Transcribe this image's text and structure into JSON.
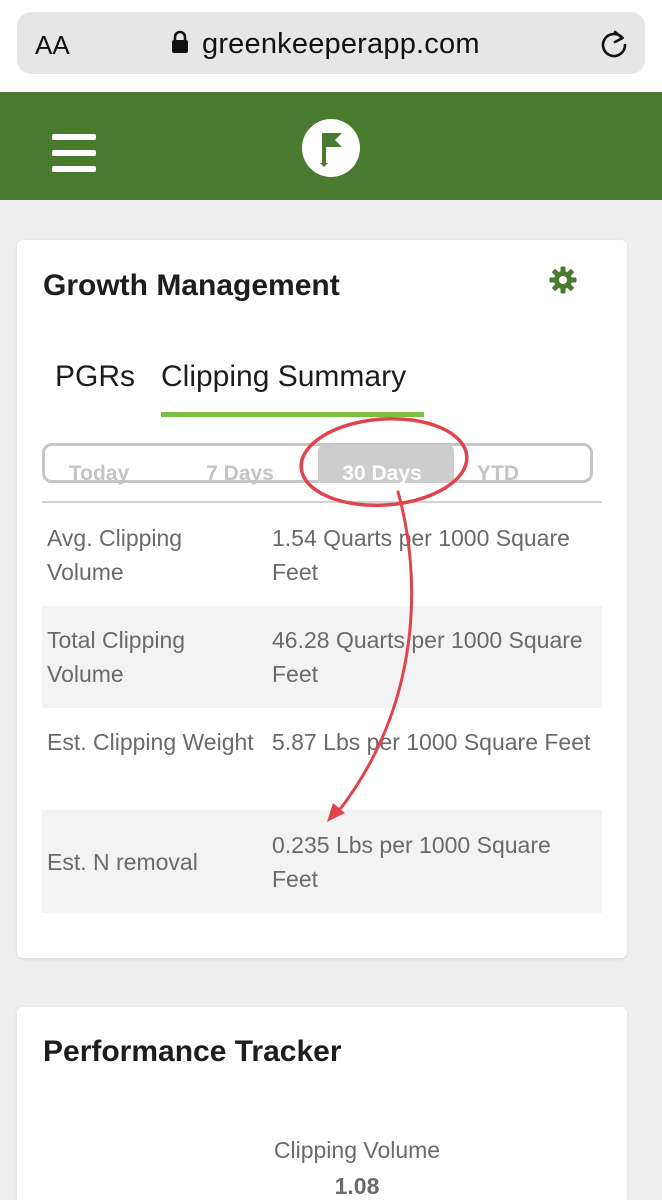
{
  "browser": {
    "text_size_label": "AA",
    "url": "greenkeeperapp.com"
  },
  "colors": {
    "header_green": "#4a7a2e",
    "accent_green": "#7cbf45",
    "annotation_red": "#e0434c"
  },
  "growth_management": {
    "title": "Growth Management",
    "tabs": [
      {
        "label": "PGRs",
        "active": false
      },
      {
        "label": "Clipping Summary",
        "active": true
      }
    ],
    "ranges": [
      {
        "label": "Today",
        "selected": false
      },
      {
        "label": "7 Days",
        "selected": false
      },
      {
        "label": "30 Days",
        "selected": true
      },
      {
        "label": "YTD",
        "selected": false
      }
    ],
    "rows": [
      {
        "label": "Avg. Clipping Volume",
        "value": "1.54 Quarts per 1000 Square Feet"
      },
      {
        "label": "Total Clipping Volume",
        "value": "46.28 Quarts per 1000 Square Feet"
      },
      {
        "label": "Est. Clipping Weight",
        "value": "5.87 Lbs per 1000 Square Feet"
      },
      {
        "label": "Est. N removal",
        "value": "0.235 Lbs per 1000 Square Feet"
      }
    ]
  },
  "performance_tracker": {
    "title": "Performance Tracker",
    "metric_label": "Clipping Volume",
    "metric_value": "1.08"
  }
}
